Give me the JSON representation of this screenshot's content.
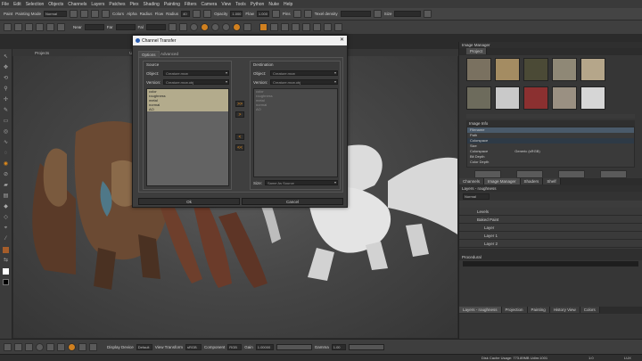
{
  "menu": [
    "File",
    "Edit",
    "Selection",
    "Objects",
    "Channels",
    "Layers",
    "Patches",
    "Ptex",
    "Shading",
    "Painting",
    "Filters",
    "Camera",
    "View",
    "Tools",
    "Python",
    "Nuke",
    "Help"
  ],
  "toolbar1": {
    "paint_label": "Paint",
    "painting_mode_label": "Painting Mode",
    "painting_mode_value": "Normal",
    "colors_label": "Colors",
    "alpha_label": "Alpha",
    "radius_label": "Radius",
    "flow_label": "Flow",
    "radius2_label": "Radius",
    "radius_value": "40",
    "opacity_label": "Opacity",
    "opacity_value": "1.000",
    "flow2_label": "Flow",
    "flow_value": "1.000",
    "pins_label": "Pins",
    "texel_density_label": "Texel density",
    "size_label": "Size"
  },
  "toolbar2": {
    "near_label": "Near",
    "far_label": "Far",
    "fal_label": "Fal"
  },
  "viewport_tabs": [
    "Projects",
    "UV"
  ],
  "dialog": {
    "title": "Channel Transfer",
    "tabs": [
      "Options",
      "Advanced"
    ],
    "source": {
      "label": "Source",
      "object_label": "Object:",
      "object_value": "Creature.mcw",
      "version_label": "Version:",
      "version_value": "Creature.mcw.obj",
      "channels": [
        "color",
        "roughness",
        "metal",
        "normal",
        "AO"
      ]
    },
    "destination": {
      "label": "Destination",
      "object_label": "Object:",
      "object_value": "Creature.mcw",
      "version_label": "Version:",
      "version_value": "Creature.mcw.obj",
      "channels": [
        "color",
        "roughness",
        "metal",
        "normal",
        "AO"
      ]
    },
    "size_label": "Size:",
    "size_value": "Same As Source",
    "ok_label": "Ok",
    "cancel_label": "Cancel",
    "arrows": [
      ">>",
      ">",
      "<",
      "<<"
    ]
  },
  "image_manager": {
    "title": "Image Manager",
    "tab": "Project",
    "image_info_label": "Image Info",
    "info_rows": [
      "Filename",
      "Path",
      "Colorspace",
      "Size",
      "Colorspace",
      "Bit Depth",
      "Color Depth"
    ],
    "info_values": [
      "",
      "",
      "",
      "",
      "Generic (sRGB)",
      "",
      ""
    ],
    "bottom_tabs": [
      "Channels",
      "Image Manager",
      "Shaders",
      "Shelf"
    ]
  },
  "layers": {
    "title": "Layers - roughness",
    "blend_mode": "Normal",
    "rows": [
      "Levels",
      "Baked Paint",
      "Layer",
      "Layer 1",
      "Layer 2"
    ],
    "procedural_label": "Procedural",
    "bottom_tabs": [
      "Layers - roughness",
      "Projection",
      "Painting",
      "History View",
      "Colors"
    ]
  },
  "bottombar": {
    "display_device_label": "Display Device",
    "display_device_value": "Default",
    "view_transform_label": "View Transform",
    "view_transform_value": "sRGB",
    "component_label": "Component",
    "component_value": "RGB",
    "gain_label": "Gain",
    "gain_value": "1.00000",
    "gamma_label": "Gamma",
    "gamma_value": "1.00"
  },
  "status": {
    "cache": "Disk Cache Usage: 773.89MB Udim:1001",
    "zoom": "1:0",
    "lock": "LUX"
  }
}
